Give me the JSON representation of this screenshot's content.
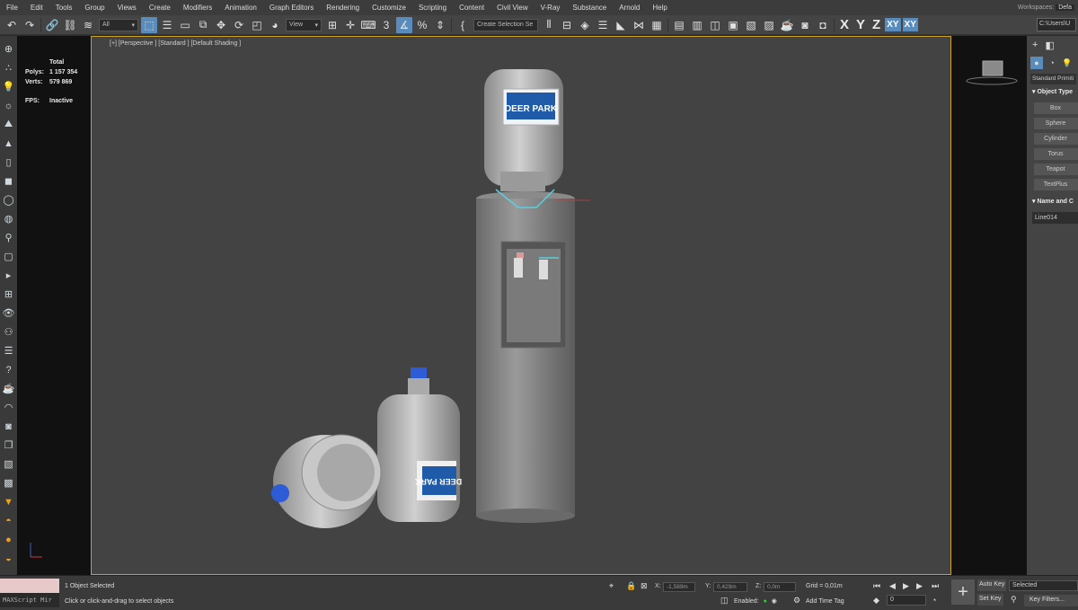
{
  "menu": [
    "File",
    "Edit",
    "Tools",
    "Group",
    "Views",
    "Create",
    "Modifiers",
    "Animation",
    "Graph Editors",
    "Rendering",
    "Customize",
    "Scripting",
    "Content",
    "Civil View",
    "V-Ray",
    "Substance",
    "Arnold",
    "Help"
  ],
  "workspaces": {
    "label": "Workspaces:",
    "value": "Defa"
  },
  "toolbar": {
    "filter_value": "All",
    "view_value": "View",
    "selection_set_value": "Create Selection Se",
    "axis_x": "X",
    "axis_y": "Y",
    "axis_z": "Z",
    "axis_xy": "XY",
    "axis_xy2": "XY",
    "path_value": "C:\\Users\\U"
  },
  "stats": {
    "total_label": "Total",
    "polys_label": "Polys:",
    "polys_value": "1 157 354",
    "verts_label": "Verts:",
    "verts_value": "579 869",
    "fps_label": "FPS:",
    "fps_value": "Inactive"
  },
  "viewport": {
    "label": "[+] [Perspective ] [Standard ] [Default Shading ]",
    "brand": "DEER PARK",
    "brand_mirrored": "DEER PARK"
  },
  "command_panel": {
    "dropdown": "Standard Primiti",
    "object_type_title": "Object Type",
    "buttons": [
      "Box",
      "Sphere",
      "Cylinder",
      "Torus",
      "Teapot",
      "TextPlus"
    ],
    "name_color_title": "Name and C",
    "name_value": "Line014"
  },
  "status": {
    "maxscript": "MAXScript Mir",
    "selected": "1 Object Selected",
    "hint": "Click or click-and-drag to select objects",
    "x_label": "X:",
    "x_value": "-1,589m",
    "y_label": "Y:",
    "y_value": "0,429m",
    "z_label": "Z:",
    "z_value": "0,0m",
    "grid": "Grid = 0,01m",
    "enabled": "Enabled:",
    "add_time_tag": "Add Time Tag",
    "frame": "0",
    "auto_key": "Auto Key",
    "set_key": "Set Key",
    "selected_combo": "Selected",
    "key_filters": "Key Filters..."
  }
}
